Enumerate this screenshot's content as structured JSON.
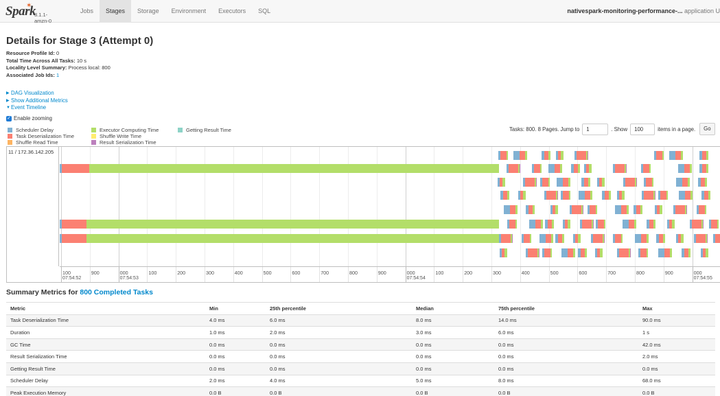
{
  "nav": {
    "logo": "Spark",
    "version": "3.1.1-amzn-0",
    "tabs": [
      "Jobs",
      "Stages",
      "Storage",
      "Environment",
      "Executors",
      "SQL"
    ],
    "active_tab": "Stages",
    "app_name": "nativespark-monitoring-performance-...",
    "app_suffix": "application U"
  },
  "page": {
    "title": "Details for Stage 3 (Attempt 0)",
    "info": [
      {
        "label": "Resource Profile Id:",
        "value": "0"
      },
      {
        "label": "Total Time Across All Tasks:",
        "value": "10 s"
      },
      {
        "label": "Locality Level Summary:",
        "value": "Process local: 800"
      },
      {
        "label": "Associated Job Ids:",
        "value": "1"
      }
    ],
    "toggles": [
      {
        "caret": "▶",
        "label": "DAG Visualization"
      },
      {
        "caret": "▶",
        "label": "Show Additional Metrics"
      },
      {
        "caret": "▼",
        "label": "Event Timeline"
      }
    ],
    "enable_zooming": "Enable zooming"
  },
  "legend": [
    {
      "label": "Scheduler Delay",
      "color": "#80b1d3"
    },
    {
      "label": "Task Deserialization Time",
      "color": "#fb8072"
    },
    {
      "label": "Shuffle Read Time",
      "color": "#fdb462"
    },
    {
      "label": "Executor Computing Time",
      "color": "#b3de69"
    },
    {
      "label": "Shuffle Write Time",
      "color": "#ffed6f"
    },
    {
      "label": "Result Serialization Time",
      "color": "#bc80bd"
    },
    {
      "label": "Getting Result Time",
      "color": "#8dd3c7"
    }
  ],
  "pager": {
    "prefix": "Tasks: 800. 8 Pages. Jump to",
    "page_value": "1",
    "show_label": ". Show",
    "show_value": "100",
    "suffix": "items in a page.",
    "go": "Go"
  },
  "timeline": {
    "executor": "11 / 172.36.142.205",
    "ticks": [
      "100",
      "900",
      "000",
      "100",
      "200",
      "300",
      "400",
      "500",
      "600",
      "700",
      "800",
      "900",
      "000",
      "100",
      "200",
      "300",
      "400",
      "500",
      "600",
      "700",
      "800",
      "900",
      "000",
      "1"
    ],
    "major_labels": [
      "07:54:52",
      "07:54:53",
      "07:54:54",
      "07:54:55"
    ]
  },
  "summary": {
    "title_prefix": "Summary Metrics for",
    "title_link": "800 Completed Tasks",
    "headers": [
      "Metric",
      "Min",
      "25th percentile",
      "Median",
      "75th percentile",
      "Max"
    ],
    "rows": [
      [
        "Task Deserialization Time",
        "4.0 ms",
        "6.0 ms",
        "8.0 ms",
        "14.0 ms",
        "90.0 ms"
      ],
      [
        "Duration",
        "1.0 ms",
        "2.0 ms",
        "3.0 ms",
        "6.0 ms",
        "1 s"
      ],
      [
        "GC Time",
        "0.0 ms",
        "0.0 ms",
        "0.0 ms",
        "0.0 ms",
        "42.0 ms"
      ],
      [
        "Result Serialization Time",
        "0.0 ms",
        "0.0 ms",
        "0.0 ms",
        "0.0 ms",
        "2.0 ms"
      ],
      [
        "Getting Result Time",
        "0.0 ms",
        "0.0 ms",
        "0.0 ms",
        "0.0 ms",
        "0.0 ms"
      ],
      [
        "Scheduler Delay",
        "2.0 ms",
        "4.0 ms",
        "5.0 ms",
        "8.0 ms",
        "68.0 ms"
      ],
      [
        "Peak Execution Memory",
        "0.0 B",
        "0.0 B",
        "0.0 B",
        "0.0 B",
        "0.0 B"
      ]
    ]
  }
}
